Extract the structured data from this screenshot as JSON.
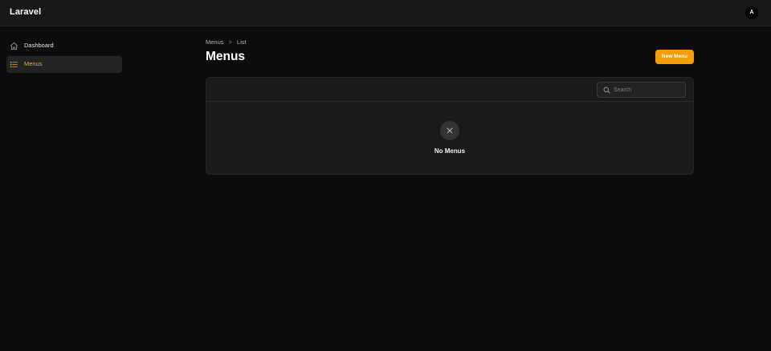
{
  "app": {
    "brand": "Laravel",
    "avatar_initial": "A"
  },
  "sidebar": {
    "items": [
      {
        "label": "Dashboard",
        "icon": "home-icon",
        "active": false
      },
      {
        "label": "Menus",
        "icon": "list-icon",
        "active": true
      }
    ]
  },
  "breadcrumb": {
    "parent": "Menus",
    "separator": ">",
    "current": "List"
  },
  "page": {
    "title": "Menus"
  },
  "actions": {
    "new_label": "New Menu"
  },
  "table": {
    "search": {
      "placeholder": "Search",
      "value": ""
    },
    "empty": {
      "icon": "close-icon",
      "heading": "No Menus"
    }
  },
  "colors": {
    "accent": "#f59e0b",
    "background": "#0c0c0c",
    "topbar": "#181818",
    "card": "#1a1a1b"
  }
}
